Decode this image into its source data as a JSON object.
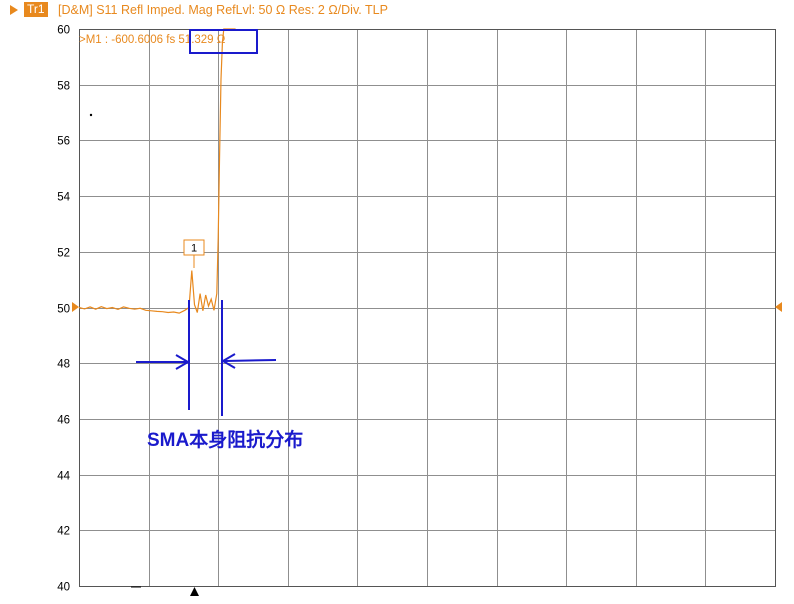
{
  "header": {
    "trace_id": "Tr1",
    "trace_description": "[D&M] S11 Refl Imped. Mag RefLvl: 50  Ω Res: 2  Ω/Div. TLP"
  },
  "colors": {
    "trace": "#e8891e",
    "annotation": "#1a1acc",
    "grid": "#8f8f8f",
    "axis_text": "#000000"
  },
  "marker": {
    "readout": ">M1 :  -600.6006 fs  51.329  Ω",
    "label": "1"
  },
  "annotation": {
    "text": "SMA本身阻抗分布"
  },
  "chart_data": {
    "type": "line",
    "title": "",
    "xlabel": "",
    "ylabel": "",
    "ylim": [
      40,
      60
    ],
    "y_ticks": [
      60,
      58,
      56,
      54,
      52,
      50,
      48,
      46,
      44,
      42,
      40
    ],
    "x_divisions": 10,
    "grid": true,
    "reference_level": 50,
    "series": [
      {
        "x": [
          0.0,
          0.08,
          0.16,
          0.24,
          0.32,
          0.4,
          0.48,
          0.56,
          0.64,
          0.72,
          0.8,
          0.88,
          0.96,
          1.04,
          1.12,
          1.2,
          1.28,
          1.36,
          1.44,
          1.52,
          1.58,
          1.62,
          1.66,
          1.7,
          1.74,
          1.78,
          1.82,
          1.86,
          1.9,
          1.94,
          1.98,
          2.0,
          2.02,
          2.04,
          2.06,
          2.08,
          2.1,
          2.12,
          2.16,
          2.25
        ],
        "y": [
          50.0,
          49.95,
          50.02,
          49.94,
          50.03,
          49.96,
          50.0,
          49.93,
          50.02,
          49.97,
          49.94,
          49.97,
          49.9,
          49.88,
          49.86,
          49.85,
          49.82,
          49.84,
          49.8,
          49.9,
          50.0,
          51.33,
          50.1,
          49.82,
          50.5,
          49.88,
          50.45,
          50.05,
          50.3,
          49.9,
          50.5,
          52.5,
          55.5,
          58.2,
          59.5,
          60.0,
          60.0,
          60.0,
          60.0,
          60.0
        ]
      }
    ]
  }
}
